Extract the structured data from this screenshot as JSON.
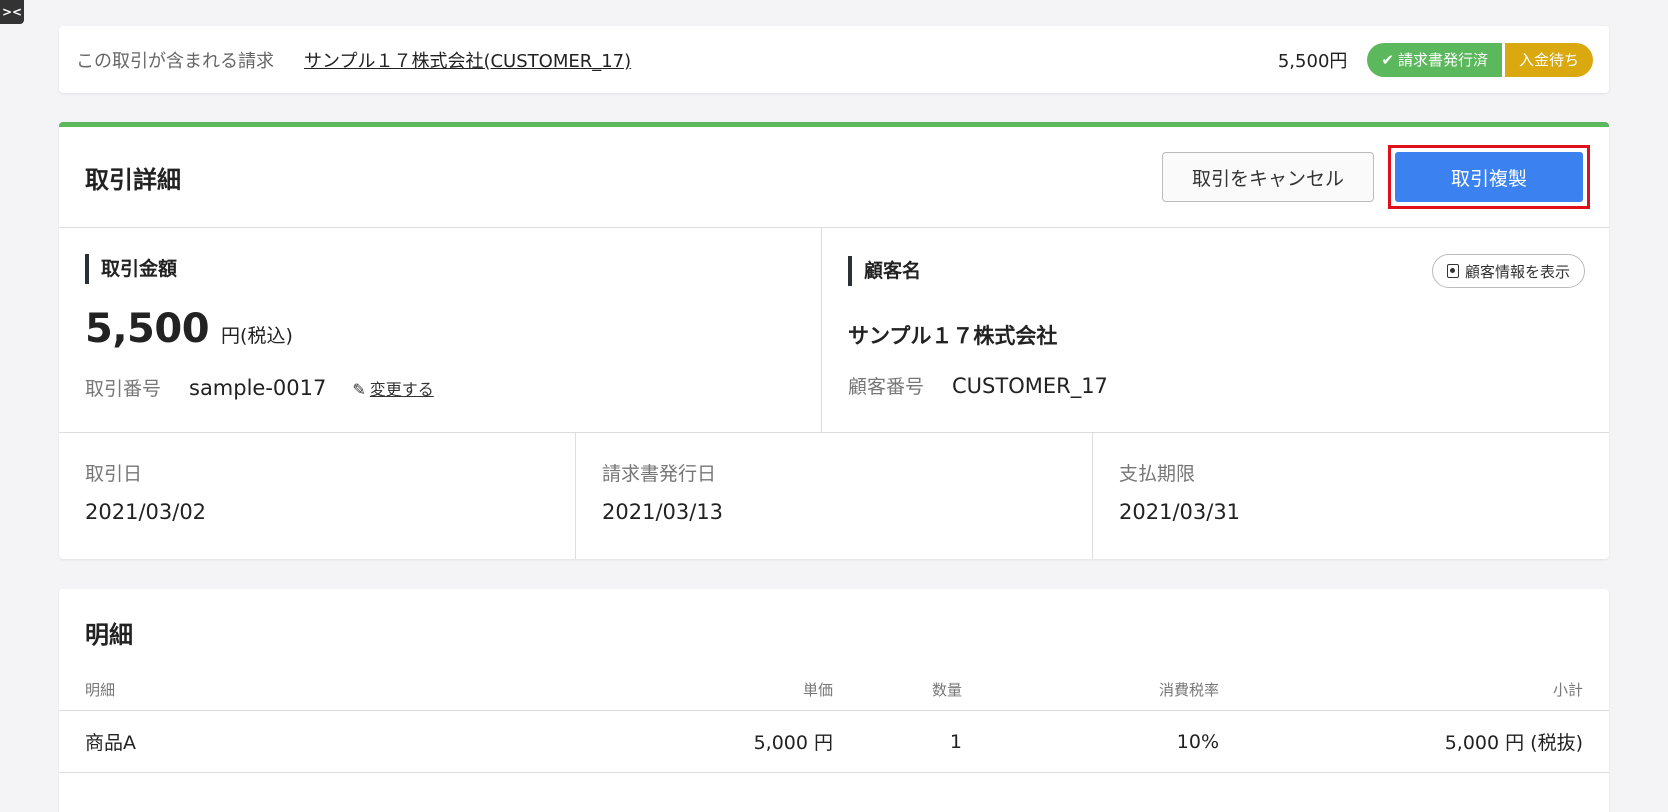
{
  "corner_toggle": "><",
  "invoice_bar": {
    "label": "この取引が含まれる請求",
    "link": "サンプル１７株式会社(CUSTOMER_17)",
    "amount": "5,500円",
    "badge_issued": "請求書発行済",
    "badge_pending": "入金待ち",
    "colors": {
      "issued": "#5cb85c",
      "pending": "#d9a90f"
    }
  },
  "detail": {
    "title": "取引詳細",
    "cancel_label": "取引をキャンセル",
    "duplicate_label": "取引複製",
    "amount_section": {
      "title": "取引金額",
      "amount": "5,500",
      "unit": "円(税込)",
      "number_label": "取引番号",
      "number_value": "sample-0017",
      "edit_label": "変更する"
    },
    "customer_section": {
      "title": "顧客名",
      "show_info_label": "顧客情報を表示",
      "name": "サンプル１７株式会社",
      "number_label": "顧客番号",
      "number_value": "CUSTOMER_17"
    },
    "dates": [
      {
        "label": "取引日",
        "value": "2021/03/02"
      },
      {
        "label": "請求書発行日",
        "value": "2021/03/13"
      },
      {
        "label": "支払期限",
        "value": "2021/03/31"
      }
    ]
  },
  "items": {
    "title": "明細",
    "headers": {
      "name": "明細",
      "price": "単価",
      "qty": "数量",
      "tax": "消費税率",
      "subtotal": "小計"
    },
    "rows": [
      {
        "name": "商品A",
        "price": "5,000 円",
        "qty": "1",
        "tax": "10%",
        "subtotal": "5,000 円 (税抜)"
      }
    ]
  }
}
